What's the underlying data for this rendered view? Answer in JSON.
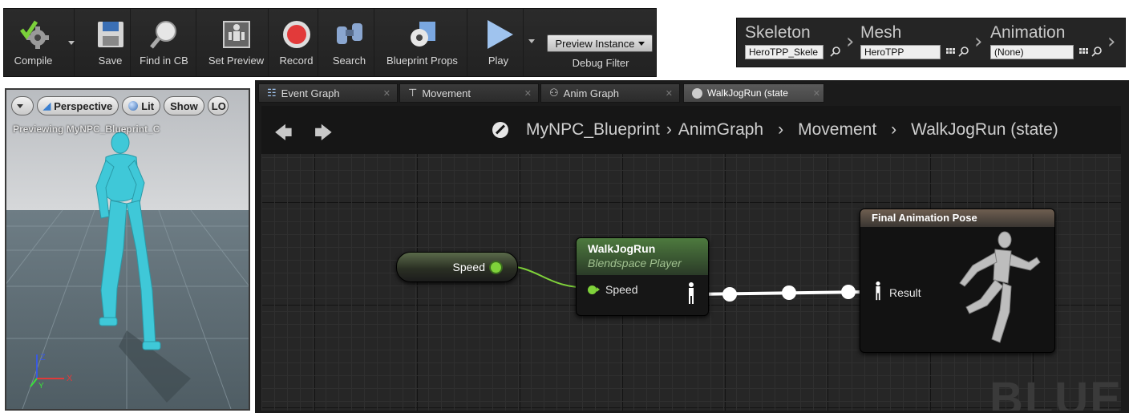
{
  "toolbar": {
    "compile": "Compile",
    "save": "Save",
    "find_in_cb": "Find in CB",
    "set_preview": "Set Preview",
    "record": "Record",
    "search": "Search",
    "blueprint_props": "Blueprint Props",
    "play": "Play",
    "preview_instance": "Preview Instance",
    "debug_filter": "Debug Filter"
  },
  "persona": {
    "skeleton": {
      "title": "Skeleton",
      "value": "HeroTPP_Skele"
    },
    "mesh": {
      "title": "Mesh",
      "value": "HeroTPP"
    },
    "animation": {
      "title": "Animation",
      "value": "(None)"
    }
  },
  "viewport": {
    "perspective": "Perspective",
    "lit": "Lit",
    "show": "Show",
    "lod": "LO",
    "previewing": "Previewing MyNPC_Blueprint_C",
    "axis_z": "Z",
    "axis_x": "X",
    "axis_y": "Y"
  },
  "tabs": [
    {
      "label": "Event Graph",
      "icon": "event-graph-icon"
    },
    {
      "label": "Movement",
      "icon": "state-machine-icon"
    },
    {
      "label": "Anim Graph",
      "icon": "anim-graph-icon"
    },
    {
      "label": "WalkJogRun (state",
      "icon": "state-icon",
      "active": true
    }
  ],
  "breadcrumb": {
    "items": [
      "MyNPC_Blueprint",
      "AnimGraph",
      "Movement",
      "WalkJogRun (state)"
    ]
  },
  "nodes": {
    "speed_var": {
      "label": "Speed"
    },
    "blendspace": {
      "title": "WalkJogRun",
      "subtitle": "Blendspace Player",
      "pin": "Speed"
    },
    "final_pose": {
      "title": "Final Animation Pose",
      "pin": "Result"
    }
  },
  "watermark": "BLUEF",
  "colors": {
    "accent_green": "#6fdc3a",
    "mannequin": "#3fc8d8"
  }
}
